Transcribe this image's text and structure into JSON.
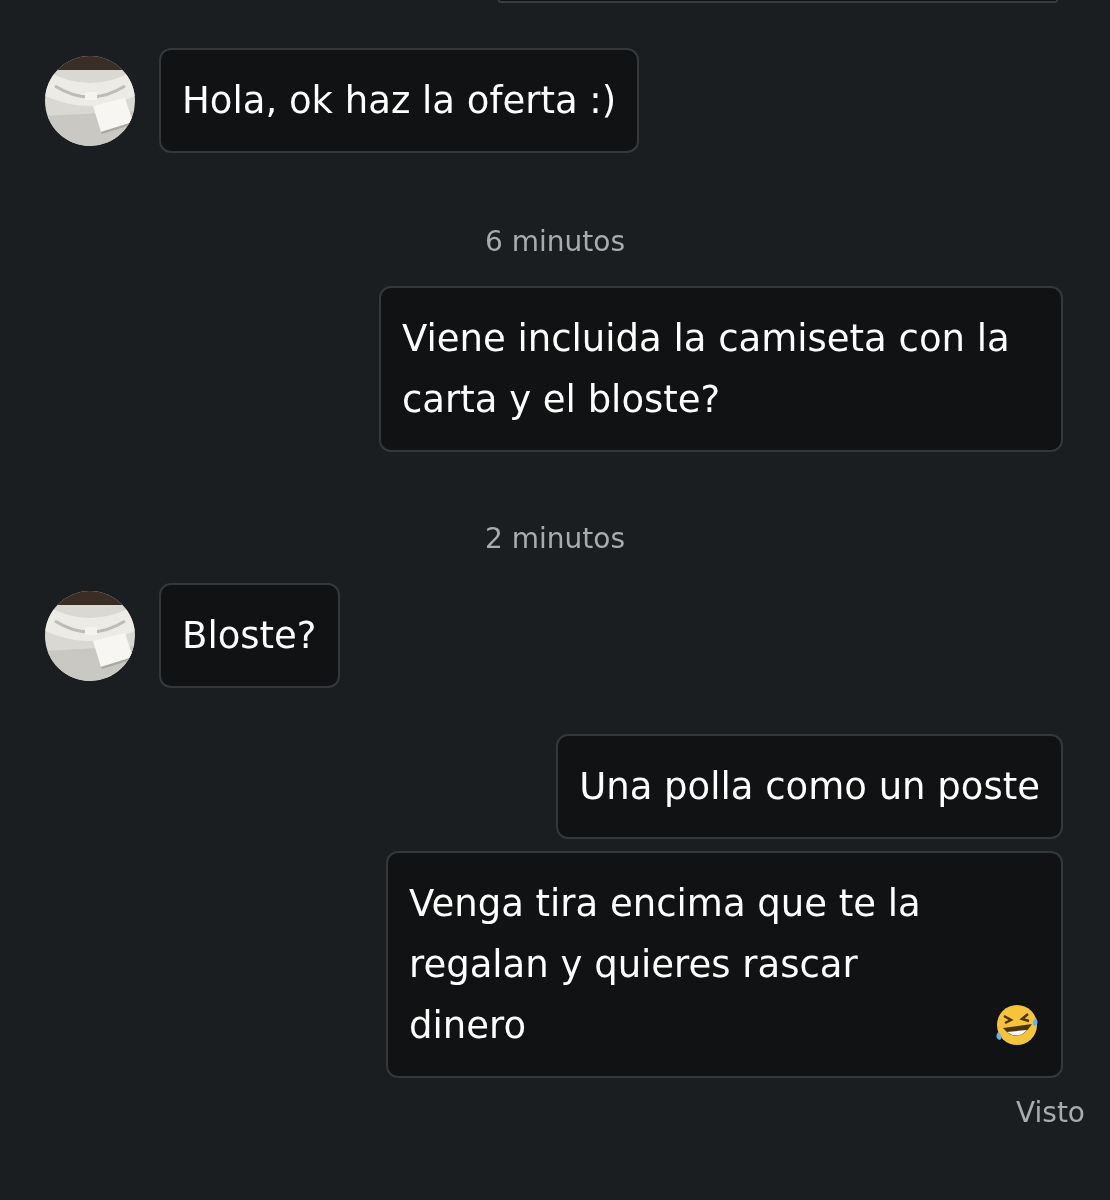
{
  "messages": [
    {
      "kind": "cut_off"
    },
    {
      "kind": "incoming",
      "text": "Hola, ok haz la oferta :)"
    },
    {
      "kind": "timestamp",
      "text": "6 minutos"
    },
    {
      "kind": "outgoing",
      "text": "Viene incluida la camiseta con la carta y el bloste?"
    },
    {
      "kind": "timestamp",
      "text": "2 minutos"
    },
    {
      "kind": "incoming",
      "text": "Bloste?"
    },
    {
      "kind": "outgoing",
      "text": "Una polla como un poste"
    },
    {
      "kind": "outgoing",
      "text": "Venga tira encima que te la regalan y quieres rascar dinero",
      "emoji": {
        "kind": "laughing"
      }
    },
    {
      "kind": "receipt",
      "text": "Visto"
    }
  ]
}
